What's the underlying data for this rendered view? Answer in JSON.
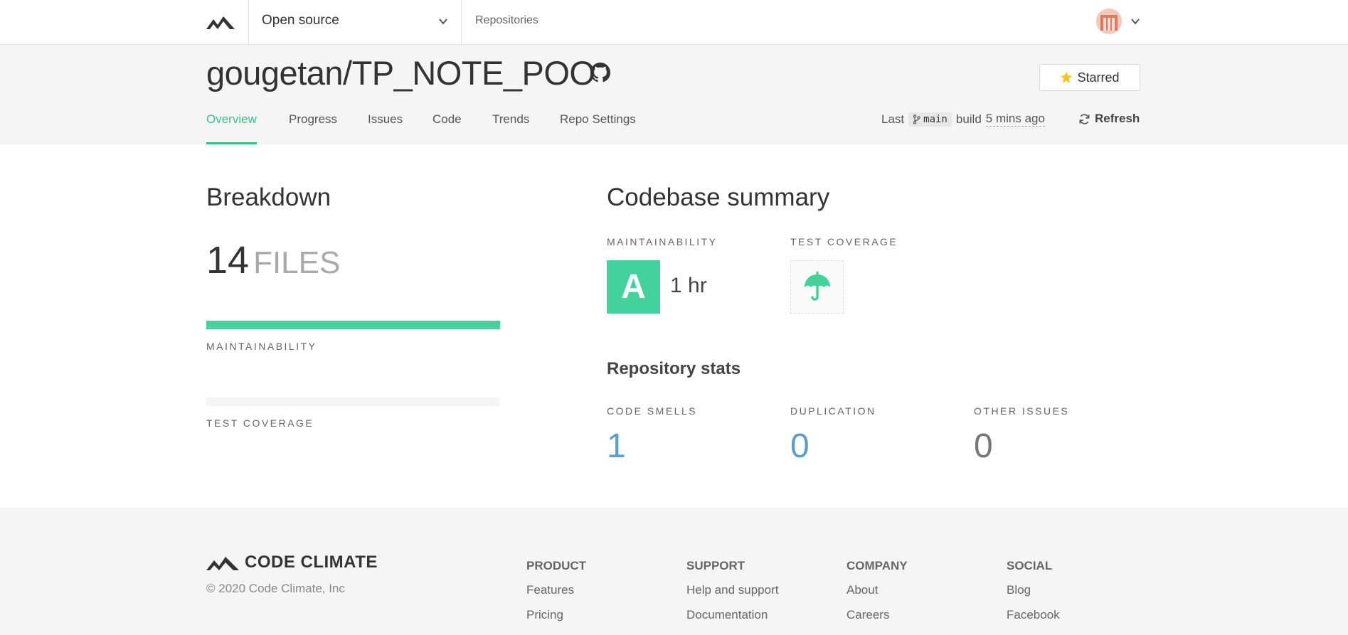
{
  "nav": {
    "org": "Open source",
    "repositories": "Repositories"
  },
  "repo": {
    "title": "gougetan/TP_NOTE_POO",
    "star_label": "Starred",
    "tabs": [
      "Overview",
      "Progress",
      "Issues",
      "Code",
      "Trends",
      "Repo Settings"
    ],
    "build": {
      "last": "Last",
      "branch": "main",
      "build": "build",
      "time_ago": "5 mins ago"
    },
    "refresh": "Refresh"
  },
  "breakdown": {
    "title": "Breakdown",
    "files_count": "14",
    "files_unit": "FILES",
    "maintainability_label": "MAINTAINABILITY",
    "maintainability_fill": 1.0,
    "test_coverage_label": "TEST COVERAGE",
    "test_coverage_fill": 0
  },
  "summary": {
    "title": "Codebase summary",
    "maintainability_label": "MAINTAINABILITY",
    "grade": "A",
    "grade_time": "1 hr",
    "test_coverage_label": "TEST COVERAGE"
  },
  "stats": {
    "title": "Repository stats",
    "code_smells_label": "CODE SMELLS",
    "code_smells": "1",
    "duplication_label": "DUPLICATION",
    "duplication": "0",
    "other_issues_label": "OTHER ISSUES",
    "other_issues": "0"
  },
  "footer": {
    "brand": "CODE CLIMATE",
    "copyright": "© 2020 Code Climate, Inc",
    "product": {
      "head": "PRODUCT",
      "links": [
        "Features",
        "Pricing"
      ]
    },
    "support": {
      "head": "SUPPORT",
      "links": [
        "Help and support",
        "Documentation"
      ]
    },
    "company": {
      "head": "COMPANY",
      "links": [
        "About",
        "Careers"
      ]
    },
    "social": {
      "head": "SOCIAL",
      "links": [
        "Blog",
        "Facebook"
      ]
    }
  },
  "colors": {
    "accent": "#3dbd8c",
    "grade_a": "#45d19b",
    "stat_blue": "#5a9fc8",
    "stat_gray": "#777777",
    "star": "#f5c518"
  },
  "icons": {
    "logo": "code-climate-logo-icon",
    "github": "github-icon",
    "star": "star-icon",
    "branch": "git-branch-icon",
    "refresh": "refresh-icon",
    "coverage": "umbrella-icon"
  }
}
